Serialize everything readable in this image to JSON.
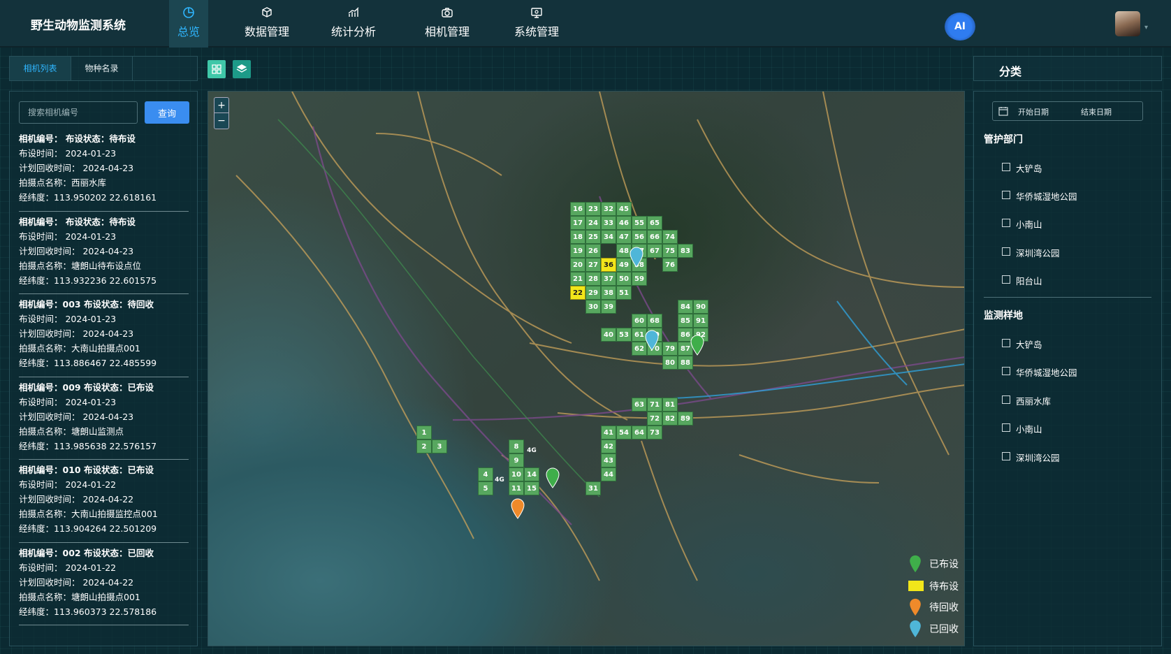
{
  "app": {
    "title": "野生动物监测系统"
  },
  "nav": [
    {
      "label": "总览",
      "icon": "pie-chart-icon",
      "active": true
    },
    {
      "label": "数据管理",
      "icon": "cube-icon"
    },
    {
      "label": "统计分析",
      "icon": "bar-chart-icon"
    },
    {
      "label": "相机管理",
      "icon": "camera-icon"
    },
    {
      "label": "系统管理",
      "icon": "monitor-icon"
    }
  ],
  "header": {
    "ai_label": "AI"
  },
  "left": {
    "tabs": [
      "相机列表",
      "物种名录"
    ],
    "search": {
      "placeholder": "搜索相机编号",
      "button": "查询"
    },
    "cameras": [
      {
        "head": "相机编号：  布设状态：待布设",
        "deploy": "布设时间：  2024-01-23",
        "recover": "计划回收时间：  2024-04-23",
        "site": "拍摄点名称：西丽水库",
        "coord": "经纬度：113.950202 22.618161"
      },
      {
        "head": "相机编号：  布设状态：待布设",
        "deploy": "布设时间：  2024-01-23",
        "recover": "计划回收时间：  2024-04-23",
        "site": "拍摄点名称：塘朗山待布设点位",
        "coord": "经纬度：113.932236 22.601575"
      },
      {
        "head": "相机编号：003  布设状态：待回收",
        "deploy": "布设时间：  2024-01-23",
        "recover": "计划回收时间：  2024-04-23",
        "site": "拍摄点名称：大南山拍摄点001",
        "coord": "经纬度：113.886467 22.485599"
      },
      {
        "head": "相机编号：009  布设状态：已布设",
        "deploy": "布设时间：  2024-01-23",
        "recover": "计划回收时间：  2024-04-23",
        "site": "拍摄点名称：塘朗山监测点",
        "coord": "经纬度：113.985638 22.576157"
      },
      {
        "head": "相机编号：010  布设状态：已布设",
        "deploy": "布设时间：  2024-01-22",
        "recover": "计划回收时间：  2024-04-22",
        "site": "拍摄点名称：大南山拍摄监控点001",
        "coord": "经纬度：113.904264 22.501209"
      },
      {
        "head": "相机编号：002  布设状态：已回收",
        "deploy": "布设时间：  2024-01-22",
        "recover": "计划回收时间：  2024-04-22",
        "site": "拍摄点名称：塘朗山拍摄点001",
        "coord": "经纬度：113.960373 22.578186"
      }
    ]
  },
  "map": {
    "zoom_in": "+",
    "zoom_out": "−",
    "grid_cells": [
      "16",
      "23",
      "32",
      "45",
      "17",
      "24",
      "33",
      "46",
      "55",
      "65",
      "18",
      "25",
      "34",
      "47",
      "56",
      "66",
      "74",
      "19",
      "26",
      "48",
      "57",
      "67",
      "75",
      "83",
      "20",
      "27",
      "36",
      "49",
      "58",
      "76",
      "21",
      "28",
      "37",
      "50",
      "59",
      "22",
      "29",
      "38",
      "51",
      "30",
      "39",
      "84",
      "90",
      "60",
      "68",
      "85",
      "91",
      "40",
      "53",
      "61",
      "69",
      "86",
      "92",
      "62",
      "70",
      "79",
      "87",
      "80",
      "88",
      "63",
      "71",
      "81",
      "72",
      "82",
      "89",
      "41",
      "54",
      "64",
      "73",
      "42",
      "43",
      "44",
      "31",
      "1",
      "2",
      "3",
      "8",
      "9",
      "10",
      "14",
      "4",
      "5",
      "11",
      "15",
      "4G",
      "4G"
    ],
    "pending_cells": [
      "36",
      "22"
    ],
    "pin_colors": {
      "deployed": "#3fae4a",
      "pending": "#f2e61a",
      "to_recover": "#ef8a2a",
      "recovered": "#4fb6d8"
    },
    "legend": [
      {
        "label": "已布设",
        "icon": "green-pin-icon"
      },
      {
        "label": "待布设",
        "icon": "yellow-square-icon"
      },
      {
        "label": "待回收",
        "icon": "orange-pin-icon"
      },
      {
        "label": "已回收",
        "icon": "blue-pin-icon"
      }
    ]
  },
  "right": {
    "title": "分类",
    "date": {
      "start": "开始日期",
      "end": "结束日期"
    },
    "departments": {
      "title": "管护部门",
      "items": [
        "大铲岛",
        "华侨城湿地公园",
        "小南山",
        "深圳湾公园",
        "阳台山"
      ]
    },
    "sites": {
      "title": "监测样地",
      "items": [
        "大铲岛",
        "华侨城湿地公园",
        "西丽水库",
        "小南山",
        "深圳湾公园"
      ]
    }
  },
  "colors": {
    "accent": "#2fb6ff",
    "button": "#3a8df0",
    "panel_border": "#28515b"
  }
}
